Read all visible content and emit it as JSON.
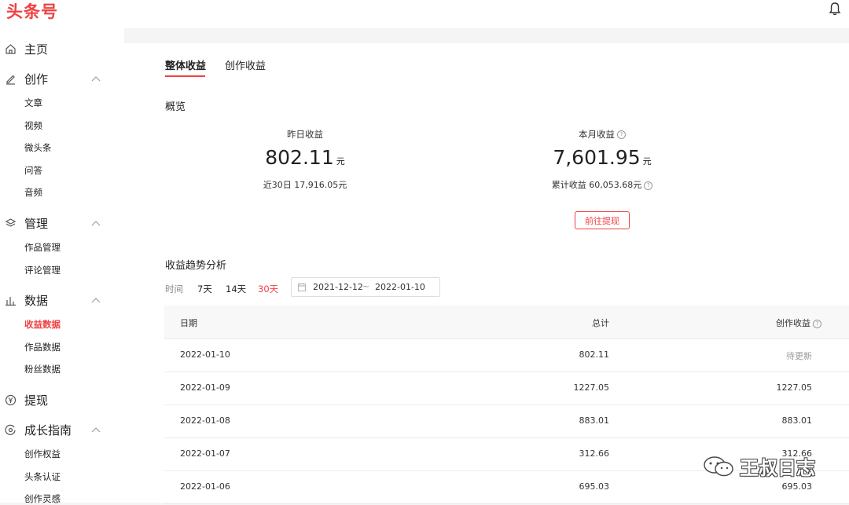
{
  "brand": {
    "logo": "头条号"
  },
  "sidebar": {
    "home": "主页",
    "create": {
      "label": "创作",
      "items": [
        "文章",
        "视频",
        "微头条",
        "问答",
        "音频"
      ]
    },
    "manage": {
      "label": "管理",
      "items": [
        "作品管理",
        "评论管理"
      ]
    },
    "data": {
      "label": "数据",
      "items": [
        "收益数据",
        "作品数据",
        "粉丝数据"
      ],
      "active": "收益数据"
    },
    "withdraw": "提现",
    "growth": {
      "label": "成长指南",
      "items": [
        "创作权益",
        "头条认证",
        "创作灵感"
      ]
    }
  },
  "tabs": {
    "overall": "整体收益",
    "creation": "创作收益"
  },
  "overview": {
    "title": "概览",
    "yesterday": {
      "label": "昨日收益",
      "value": "802.11",
      "unit": "元",
      "sub": "近30日 17,916.05元"
    },
    "month": {
      "label": "本月收益",
      "value": "7,601.95",
      "unit": "元",
      "sub": "累计收益 60,053.68元"
    },
    "withdraw_button": "前往提现"
  },
  "trend": {
    "title": "收益趋势分析",
    "time_label": "时间",
    "ranges": [
      "7天",
      "14天",
      "30天"
    ],
    "active_range": "30天",
    "start_date": "2021-12-12",
    "separator": "~",
    "end_date": "2022-01-10"
  },
  "table": {
    "headers": {
      "date": "日期",
      "total": "总计",
      "creation": "创作收益"
    },
    "rows": [
      {
        "date": "2022-01-10",
        "total": "802.11",
        "creation": "待更新"
      },
      {
        "date": "2022-01-09",
        "total": "1227.05",
        "creation": "1227.05"
      },
      {
        "date": "2022-01-08",
        "total": "883.01",
        "creation": "883.01"
      },
      {
        "date": "2022-01-07",
        "total": "312.66",
        "creation": "312.66"
      },
      {
        "date": "2022-01-06",
        "total": "695.03",
        "creation": "695.03"
      }
    ]
  },
  "watermark": "王叔日志",
  "colors": {
    "accent": "#f04142",
    "muted": "#999999"
  }
}
